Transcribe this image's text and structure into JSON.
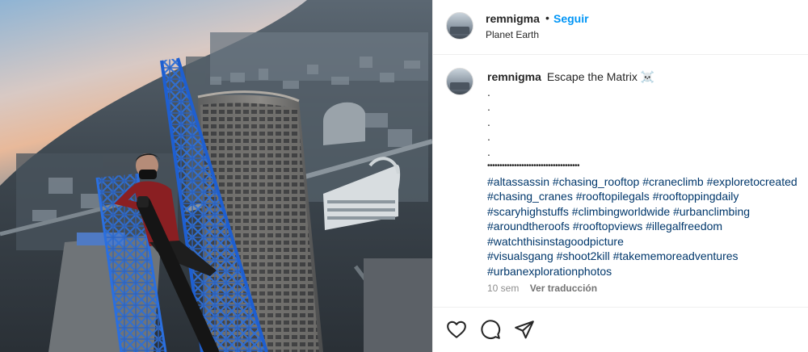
{
  "post": {
    "username": "remnigma",
    "separator": "•",
    "follow_label": "Seguir",
    "location": "Planet Earth",
    "caption_text": "Escape the Matrix ☠️",
    "caption_dots": [
      ".",
      ".",
      ".",
      ".",
      "."
    ],
    "caption_bullets": "••••••••••••••••••••••••••••••••••••••",
    "hashtags": [
      "#altassassin #chasing_rooftop #craneclimb #exploretocreated",
      "#chasing_cranes #rooftopilegals #rooftoppingdaily",
      "#scaryhighstuffs #climbingworldwide #urbanclimbing",
      "#aroundtheroofs #rooftopviews #illegalfreedom",
      "#watchthisinstagoodpicture",
      "#visualsgang #shoot2kill #takememoreadventures",
      "#urbanexplorationphotos"
    ],
    "time_ago": "10 sem",
    "translate_label": "Ver traducción"
  },
  "actions": {
    "like_icon": "heart-icon",
    "comment_icon": "comment-icon",
    "share_icon": "share-icon"
  },
  "colors": {
    "link": "#00376b",
    "follow": "#0095f6",
    "muted": "#8e8e8e",
    "text": "#262626"
  }
}
